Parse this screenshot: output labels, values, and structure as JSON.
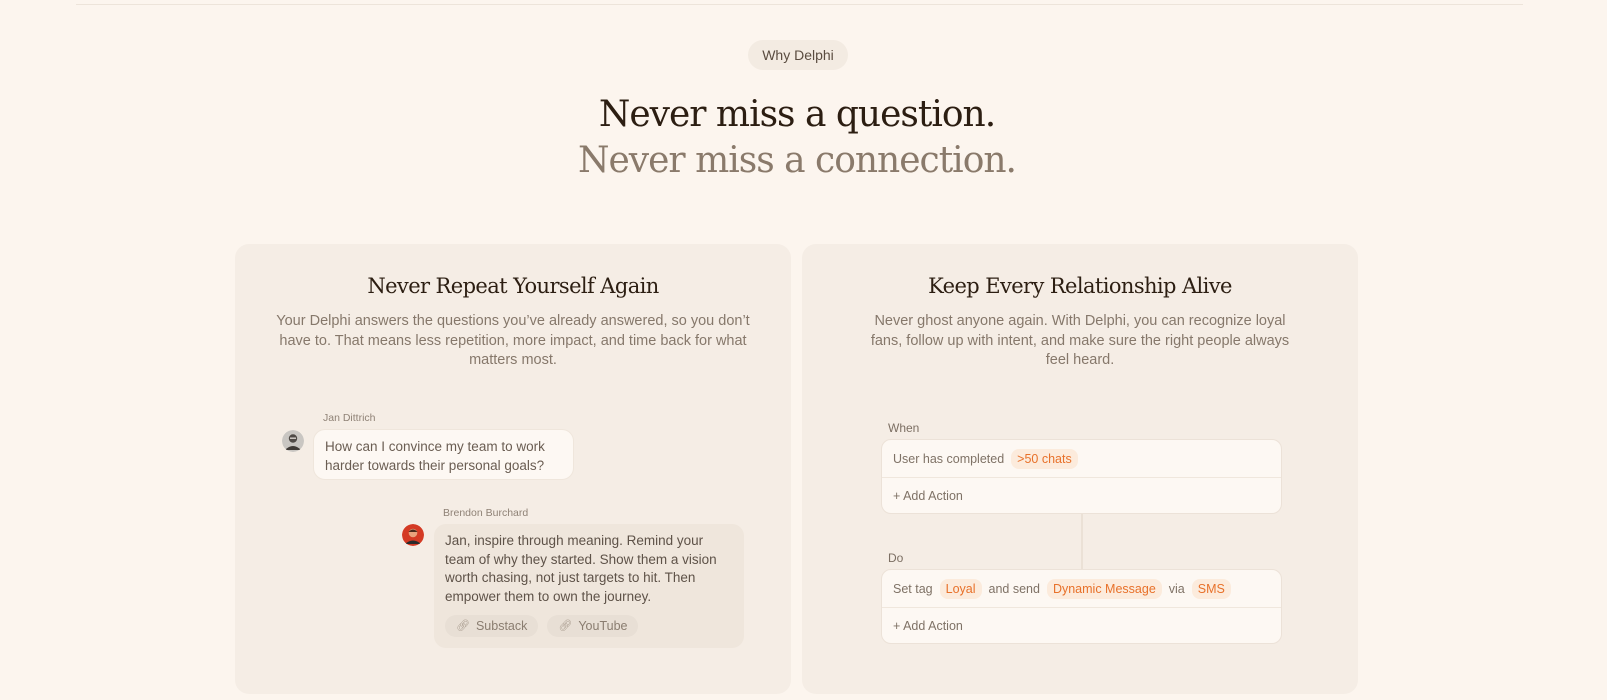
{
  "badge": "Why Delphi",
  "headline": {
    "line1": "Never miss a question.",
    "line2": "Never miss a connection."
  },
  "card_left": {
    "title": "Never Repeat Yourself Again",
    "description": "Your Delphi answers the questions you’ve already answered, so you don’t have to. That means less repetition, more impact, and time back for what matters most.",
    "chat": {
      "question_sender": "Jan Dittrich",
      "question": "How can I convince my team to work harder towards their personal goals?",
      "answer_sender": "Brendon Burchard",
      "answer": "Jan, inspire through meaning. Remind your team of why they started. Show them a vision worth chasing, not just targets to hit. Then empower them to own the journey.",
      "links": [
        "Substack",
        "YouTube"
      ]
    }
  },
  "card_right": {
    "title": "Keep Every Relationship Alive",
    "description": "Never ghost anyone again. With Delphi, you can recognize loyal fans, follow up with intent, and make sure the right people always feel heard.",
    "workflow": {
      "when_label": "When",
      "condition_text": "User has completed",
      "condition_tag": ">50 chats",
      "add_action": "+ Add Action",
      "do_label": "Do",
      "action_text1": "Set tag",
      "action_tag1": "Loyal",
      "action_text2": "and send",
      "action_tag2": "Dynamic Message",
      "action_text3": "via",
      "action_tag3": "SMS"
    }
  },
  "colors": {
    "background": "#fcf5ee",
    "card": "#f5ede5",
    "accent": "#e8712a"
  }
}
